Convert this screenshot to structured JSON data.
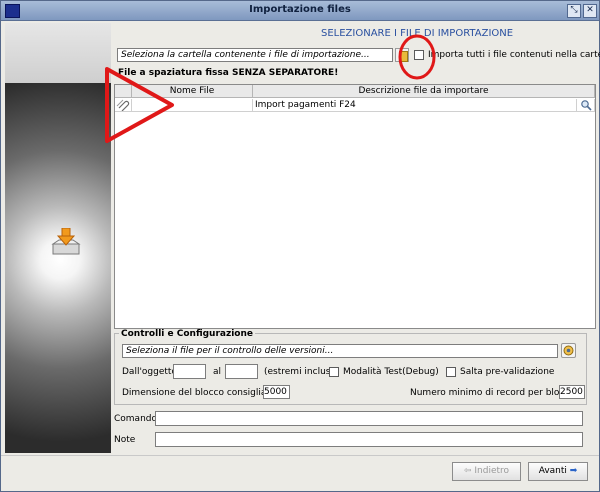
{
  "window": {
    "title": "Importazione files"
  },
  "header": {
    "section_title": "SELEZIONARE I FILE DI IMPORTAZIONE"
  },
  "folder": {
    "placeholder": "Seleziona la cartella contenente i file di importazione...",
    "import_all_label": "Importa tutti i file contenuti nella cartella"
  },
  "format_label": "File a spaziatura fissa SENZA SEPARATORE!",
  "table": {
    "columns": [
      "Nome File",
      "Descrizione file da importare"
    ],
    "rows": [
      {
        "nome_file": "",
        "descrizione": "Import pagamenti F24"
      }
    ]
  },
  "controls": {
    "title": "Controlli e Configurazione",
    "version_placeholder": "Seleziona il file per il controllo delle versioni...",
    "from_label": "Dall'oggetto",
    "to_label": "al",
    "range_note": "(estremi inclusi)",
    "test_mode_label": "Modalità Test(Debug)",
    "skip_prevalidation_label": "Salta pre-validazione",
    "block_size_label": "Dimensione del blocco consigliata",
    "block_size_value": "5000",
    "min_records_label": "Numero minimo di record per blocco",
    "min_records_value": "2500"
  },
  "comando_label": "Comando",
  "note_label": "Note",
  "nav": {
    "back_label": "Indietro",
    "next_label": "Avanti"
  },
  "colors": {
    "accent": "#2a50a0",
    "annotation": "#e01818"
  }
}
